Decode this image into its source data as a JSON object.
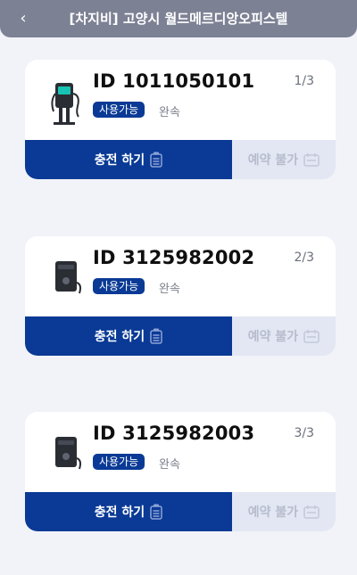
{
  "header": {
    "back_icon": "chevron-left-icon",
    "title": "[차지비] 고양시 월드메르디앙오피스텔"
  },
  "colors": {
    "header_bg": "#7c8194",
    "primary": "#0a3a95",
    "disabled_bg": "#e3e7f3",
    "page_bg": "#f1f3f8"
  },
  "chargers": [
    {
      "id_label": "ID 1011050101",
      "page": "1/3",
      "status": "사용가능",
      "availability": "완속",
      "charge_label": "충전 하기",
      "reserve_label": "예약 불가",
      "charger_icon": "ev-charger-stand-icon"
    },
    {
      "id_label": "ID 3125982002",
      "page": "2/3",
      "status": "사용가능",
      "availability": "완속",
      "charge_label": "충전 하기",
      "reserve_label": "예약 불가",
      "charger_icon": "ev-charger-wall-icon"
    },
    {
      "id_label": "ID 3125982003",
      "page": "3/3",
      "status": "사용가능",
      "availability": "완속",
      "charge_label": "충전 하기",
      "reserve_label": "예약 불가",
      "charger_icon": "ev-charger-wall-icon"
    }
  ]
}
